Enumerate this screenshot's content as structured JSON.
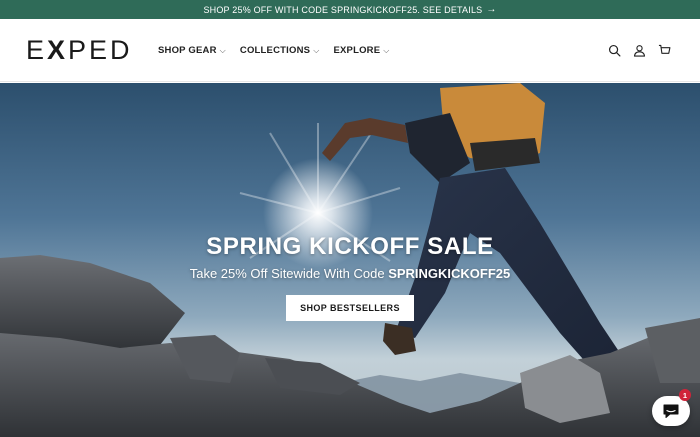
{
  "announcement": {
    "text": "SHOP 25% OFF WITH CODE SPRINGKICKOFF25. SEE DETAILS",
    "arrow": "→"
  },
  "header": {
    "logo_prefix": "E",
    "logo_x": "X",
    "logo_suffix": "PED",
    "nav": [
      {
        "label": "SHOP GEAR"
      },
      {
        "label": "COLLECTIONS"
      },
      {
        "label": "EXPLORE"
      }
    ],
    "icons": [
      "search-icon",
      "account-icon",
      "cart-icon"
    ]
  },
  "hero": {
    "title": "SPRING KICKOFF SALE",
    "subtitle_prefix": "Take 25% Off Sitewide With Code ",
    "subtitle_code": "SPRINGKICKOFF25",
    "cta": "SHOP BESTSELLERS"
  },
  "chat": {
    "badge_count": "1"
  },
  "colors": {
    "announcement_bg": "#2f6b58",
    "badge": "#d0243a"
  }
}
